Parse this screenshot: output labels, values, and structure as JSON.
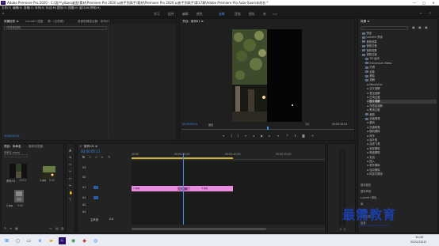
{
  "window": {
    "title": "Adobe Premiere Pro 2020 - C:\\用户\\yibao\\桌面\\素材\\Premiere Pro 2020 从新手到高手\\素材\\Premiere Pro 2020 从新手到高手\\第17章\\Adobe Premiere Pro Auto-Save\\未命名 *",
    "logo_text": "Pr",
    "minimize": "—",
    "maximize": "□",
    "close": "✕"
  },
  "menu": [
    "文件(F)",
    "编辑(E)",
    "剪辑(C)",
    "序列(S)",
    "标记(M)",
    "图形(G)",
    "视图(V)",
    "窗口(W)",
    "帮助(H)"
  ],
  "workspaces": {
    "tabs": [
      "学习",
      "组件",
      "编辑",
      "颜色",
      "效果",
      "音频",
      "图形",
      "库",
      ">>"
    ],
    "active": "效果"
  },
  "effect_controls": {
    "tabs": [
      "效果控件 ≡",
      "Lumetri 范围",
      "源：(无剪辑)",
      "音频剪辑混合器：序列01"
    ],
    "active": "效果控件 ≡",
    "body": "(未选择剪辑)",
    "timecode": "00:00:00:00"
  },
  "program_monitor": {
    "title": "节目：序列01 ≡",
    "timecode_left": "00:00:00:01",
    "fit": "适合",
    "quality": "1/2",
    "timecode_right": "00:00:10:01"
  },
  "project": {
    "tabs": [
      "项目：未命名",
      "媒体浏览器"
    ],
    "active": "项目：未命名",
    "path": "未命名.prproj",
    "items": [
      {
        "name": "序列 01",
        "duration": "10:01"
      },
      {
        "name": "1.jpg",
        "duration": "5:00"
      },
      {
        "name": "2.jpg",
        "duration": "5:00"
      }
    ]
  },
  "timeline": {
    "title": "序列 01 ≡",
    "timecode": "00:00:05:11",
    "ruler": [
      "00:00",
      "00:00:05:00",
      "00:00:10:00",
      "00:00:15:00"
    ],
    "video_tracks": [
      "V3",
      "V2",
      "V1"
    ],
    "audio_tracks": [
      "A1",
      "A2",
      "A3"
    ],
    "master": "主声道",
    "master_value": "0.0",
    "clips": [
      {
        "label": "1.jpg",
        "track": "V1"
      },
      {
        "label": "交叉溶解",
        "track": "V1"
      },
      {
        "label": "2.jpg",
        "track": "V1"
      }
    ]
  },
  "effects_panel": {
    "title": "效果 ≡",
    "tree": [
      {
        "label": "预设",
        "depth": 0
      },
      {
        "label": "Lumetri 预设",
        "depth": 0
      },
      {
        "label": "音频效果",
        "depth": 0
      },
      {
        "label": "音频过渡",
        "depth": 0
      },
      {
        "label": "视频效果",
        "depth": 0
      },
      {
        "label": "视频过渡",
        "depth": 0
      },
      {
        "label": "3D 运动",
        "depth": 1
      },
      {
        "label": "Immersive Video",
        "depth": 1
      },
      {
        "label": "内滑",
        "depth": 1
      },
      {
        "label": "划像",
        "depth": 1
      },
      {
        "label": "擦除",
        "depth": 1
      },
      {
        "label": "溶解",
        "depth": 1
      },
      {
        "label": "MorphCut",
        "depth": 2
      },
      {
        "label": "交叉溶解",
        "depth": 2
      },
      {
        "label": "叠加溶解",
        "depth": 2
      },
      {
        "label": "白场过渡",
        "depth": 2
      },
      {
        "label": "胶片溶解",
        "depth": 2
      },
      {
        "label": "非叠加溶解",
        "depth": 2
      },
      {
        "label": "黑场过渡",
        "depth": 2
      },
      {
        "label": "缩放",
        "depth": 1
      },
      {
        "label": "页面剥落",
        "depth": 1
      },
      {
        "label": "翻页",
        "depth": 2
      },
      {
        "label": "页面剥落",
        "depth": 2
      },
      {
        "label": "随机擦除",
        "depth": 2
      },
      {
        "label": "风车",
        "depth": 2
      },
      {
        "label": "百叶窗",
        "depth": 2
      },
      {
        "label": "油漆飞溅",
        "depth": 2
      },
      {
        "label": "渐变擦除",
        "depth": 2
      },
      {
        "label": "棋盘擦除",
        "depth": 2
      },
      {
        "label": "划出",
        "depth": 2
      },
      {
        "label": "插入",
        "depth": 2
      },
      {
        "label": "带状擦除",
        "depth": 2
      },
      {
        "label": "径向擦除",
        "depth": 2
      },
      {
        "label": "时钟式擦除",
        "depth": 2
      }
    ],
    "selected": "胶片溶解",
    "bottom_tabs": [
      "基本图形",
      "基本声音",
      "Lumetri 颜色",
      "库",
      "标记",
      "历史记录",
      "信息"
    ]
  },
  "watermark": {
    "text": "最需教育",
    "url": "www.zuixujiaoyu.com"
  },
  "taskbar": {
    "time": "14:49",
    "date": "2021/10/11"
  },
  "colors": {
    "accent": "#3d8cf0",
    "clip": "#e88de0",
    "watermark": "#1a3fa8"
  }
}
